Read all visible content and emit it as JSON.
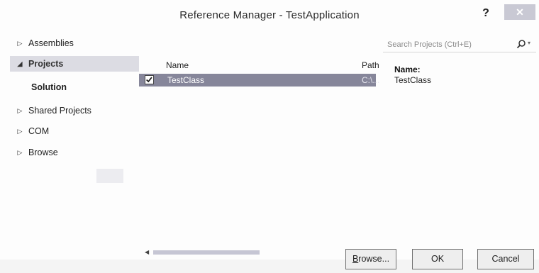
{
  "window": {
    "title": "Reference Manager - TestApplication",
    "help_label": "?",
    "close_label": "✕"
  },
  "sidebar": {
    "items": [
      {
        "label": "Assemblies",
        "arrow": "▷"
      },
      {
        "label": "Projects",
        "arrow": "◢"
      },
      {
        "label": "Solution",
        "arrow": ""
      },
      {
        "label": "Shared Projects",
        "arrow": "▷"
      },
      {
        "label": "COM",
        "arrow": "▷"
      },
      {
        "label": "Browse",
        "arrow": "▷"
      }
    ]
  },
  "search": {
    "placeholder": "Search Projects (Ctrl+E)",
    "value": "",
    "icon": "search-icon",
    "dropdown_glyph": "▾"
  },
  "list": {
    "columns": {
      "name": "Name",
      "path": "Path"
    },
    "rows": [
      {
        "checked": true,
        "name": "TestClass",
        "path": "C:\\..."
      }
    ]
  },
  "details": {
    "name_label": "Name:",
    "name_value": "TestClass"
  },
  "scrollbar": {
    "left_glyph": "◀",
    "right_glyph": "▶"
  },
  "buttons": {
    "browse_first": "B",
    "browse_rest": "rowse...",
    "ok": "OK",
    "cancel": "Cancel"
  },
  "colors": {
    "selected_row": "#86869a",
    "selected_nav": "#dcdce3",
    "close_button": "#c9c9d4"
  }
}
